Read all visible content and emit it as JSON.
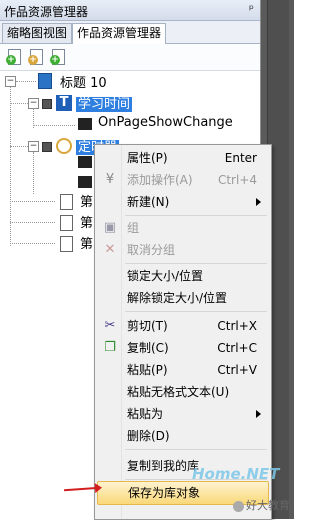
{
  "panel": {
    "title": "作品资源管理器",
    "pin_glyph": "ᵖ",
    "tabs": [
      "缩略图视图",
      "作品资源管理器"
    ]
  },
  "tree": {
    "root": "标题 10",
    "n1": "学习时间",
    "n1_child": "OnPageShowChange",
    "n2": "定时器",
    "page_prefix": "第"
  },
  "menu": {
    "items": [
      {
        "label": "属性(P)",
        "shortcut": "Enter"
      },
      {
        "label": "添加操作(A)",
        "shortcut": "Ctrl+4"
      },
      {
        "label": "新建(N)",
        "shortcut": ""
      },
      {
        "label": "组",
        "shortcut": ""
      },
      {
        "label": "取消分组",
        "shortcut": ""
      },
      {
        "label": "锁定大小/位置",
        "shortcut": ""
      },
      {
        "label": "解除锁定大小/位置",
        "shortcut": ""
      },
      {
        "label": "剪切(T)",
        "shortcut": "Ctrl+X"
      },
      {
        "label": "复制(C)",
        "shortcut": "Ctrl+C"
      },
      {
        "label": "粘贴(P)",
        "shortcut": "Ctrl+V"
      },
      {
        "label": "粘贴无格式文本(U)",
        "shortcut": ""
      },
      {
        "label": "粘贴为",
        "shortcut": ""
      },
      {
        "label": "删除(D)",
        "shortcut": ""
      },
      {
        "label": "复制到我的库",
        "shortcut": ""
      },
      {
        "label": "保存为库对象",
        "shortcut": ""
      }
    ]
  },
  "watermark": {
    "site": "Home.NET",
    "brand": "好大教育"
  }
}
